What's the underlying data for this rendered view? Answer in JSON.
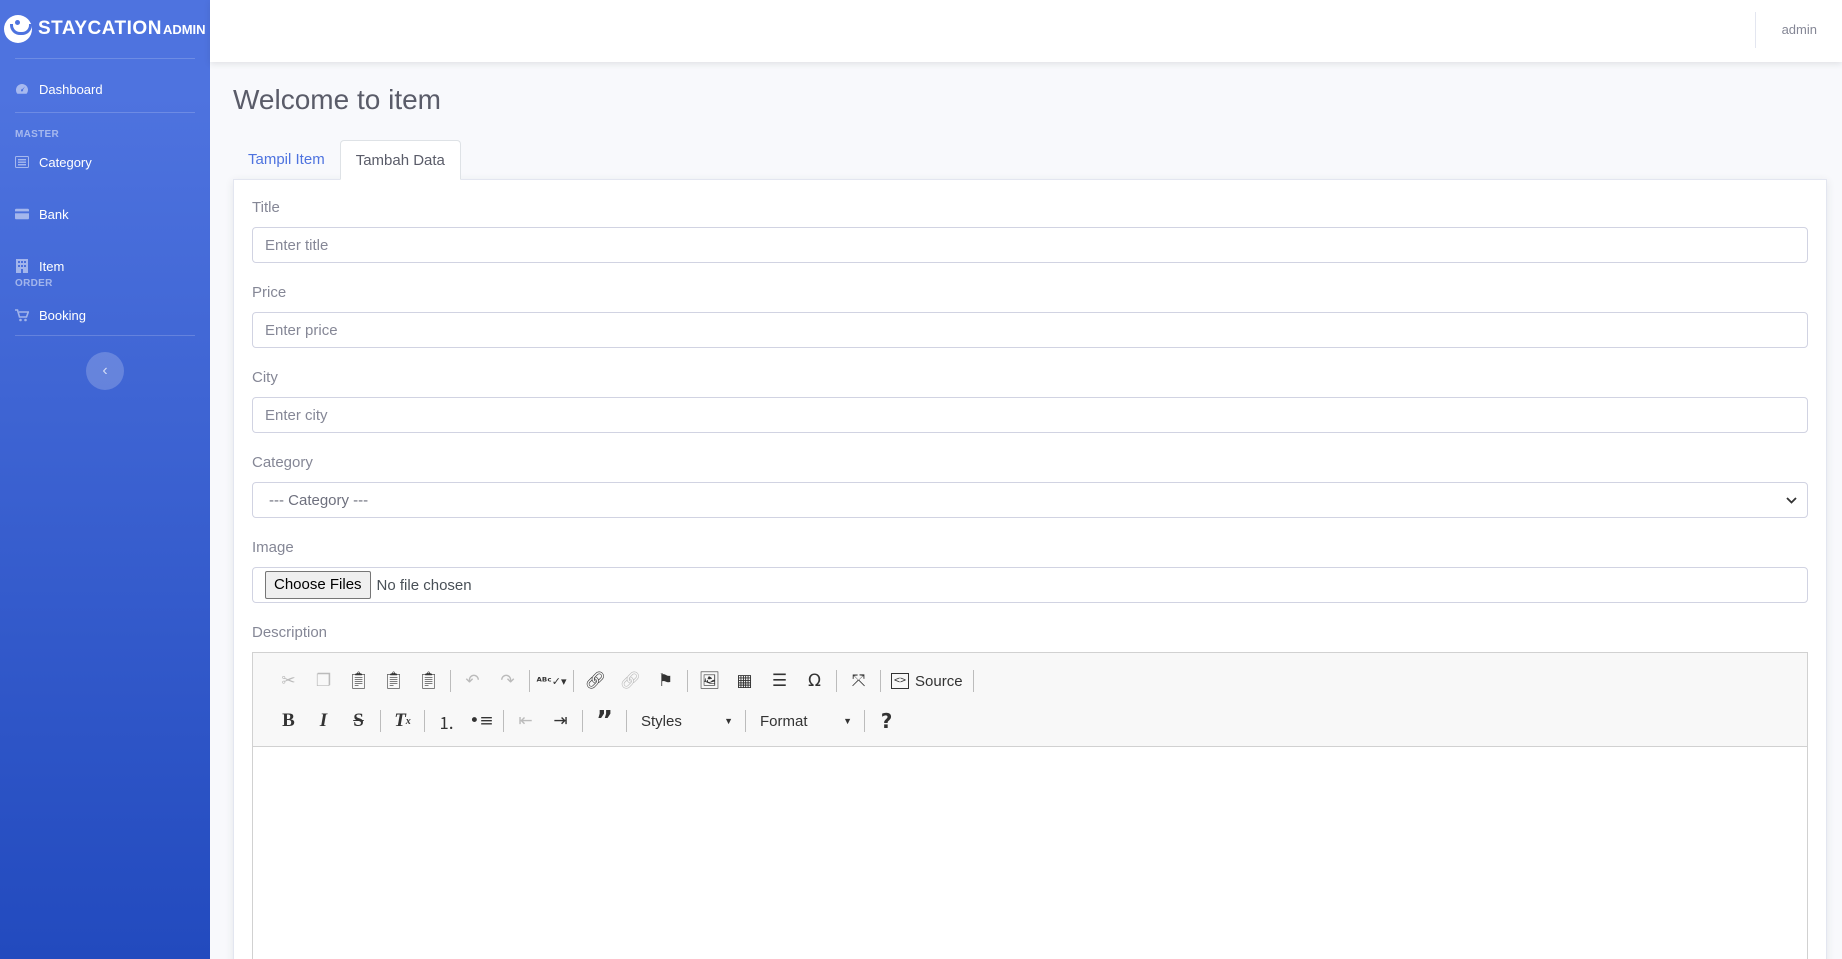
{
  "brand": {
    "name": "STAYCATION",
    "suffix": "ADMIN"
  },
  "sidebar": {
    "dashboard": "Dashboard",
    "heading_master": "MASTER",
    "category": "Category",
    "bank": "Bank",
    "item": "Item",
    "heading_order": "ORDER",
    "booking": "Booking",
    "toggle_icon": "chevron-left-icon"
  },
  "topbar": {
    "user": "admin"
  },
  "page": {
    "title": "Welcome to item"
  },
  "tabs": {
    "list": "Tampil Item",
    "add": "Tambah Data",
    "active": "Tambah Data"
  },
  "form": {
    "title_label": "Title",
    "title_placeholder": "Enter title",
    "price_label": "Price",
    "price_placeholder": "Enter price",
    "city_label": "City",
    "city_placeholder": "Enter city",
    "category_label": "Category",
    "category_selected": "--- Category ---",
    "image_label": "Image",
    "file_button": "Choose Files",
    "file_status": "No file chosen",
    "description_label": "Description"
  },
  "editor": {
    "source_label": "Source",
    "styles_label": "Styles",
    "format_label": "Format",
    "help_label": "?"
  },
  "colors": {
    "primary": "#4e73df",
    "primary_dark": "#224abe",
    "text": "#5a5c69",
    "muted": "#858796"
  }
}
